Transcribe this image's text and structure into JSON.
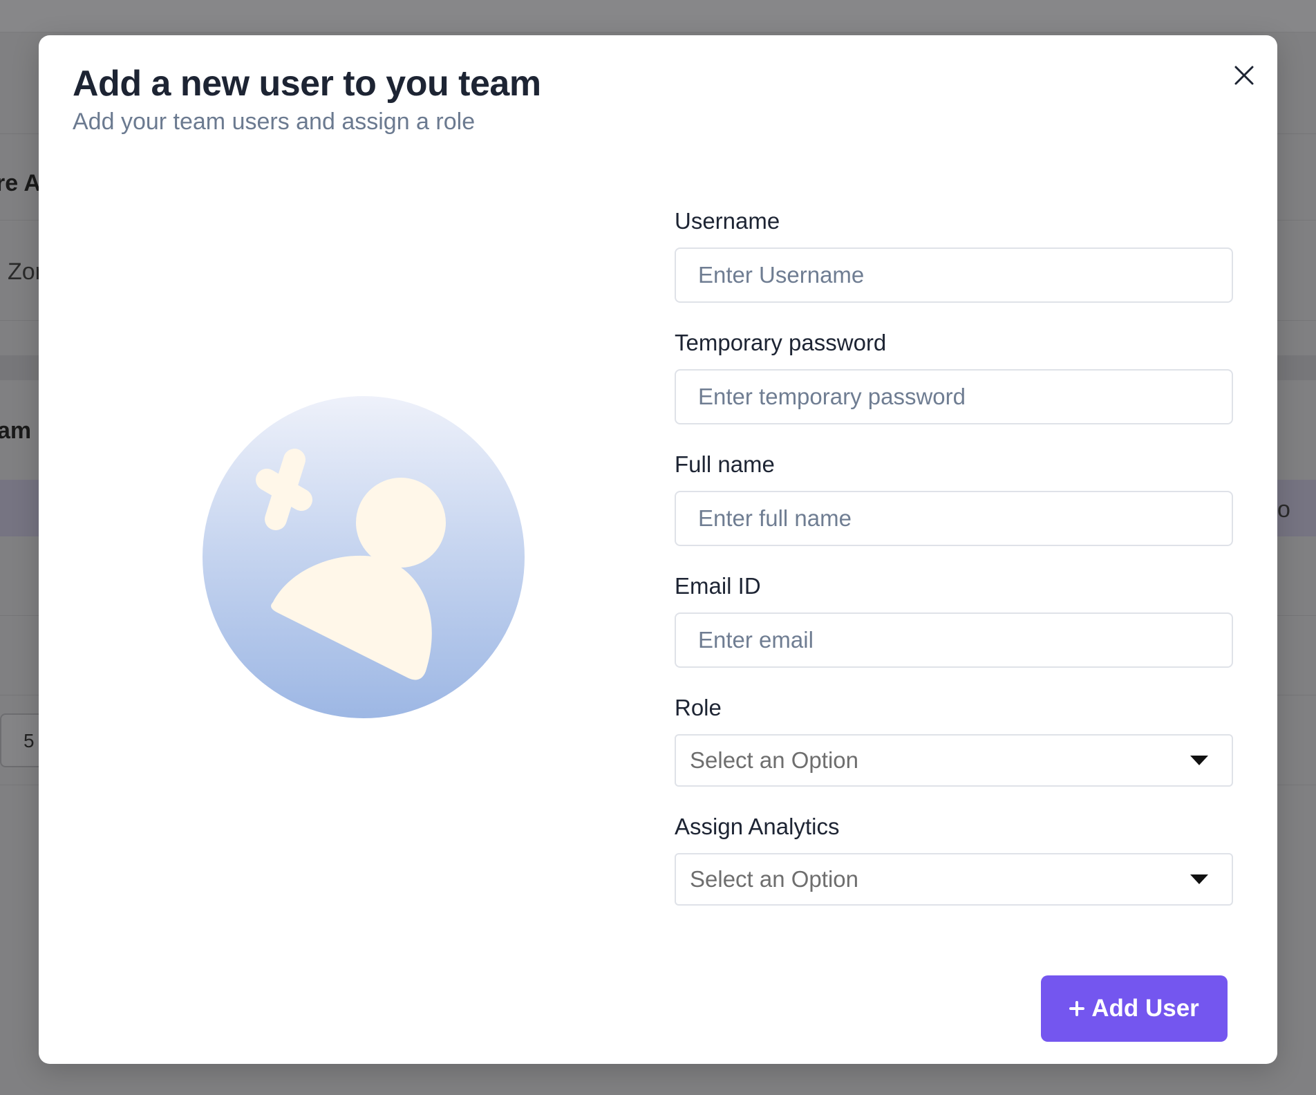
{
  "background": {
    "fragments": [
      "re A",
      "l Zon",
      "am",
      "o"
    ],
    "pager_value": "5"
  },
  "modal": {
    "title": "Add a new user to you team",
    "subtitle": "Add your team users and assign a role",
    "close_icon": "close-icon",
    "illustration_icon": "remove-user-avatar-icon",
    "fields": [
      {
        "label": "Username",
        "placeholder": "Enter Username",
        "value": ""
      },
      {
        "label": "Temporary password",
        "placeholder": "Enter temporary password",
        "value": ""
      },
      {
        "label": "Full name",
        "placeholder": "Enter full name",
        "value": ""
      },
      {
        "label": "Email ID",
        "placeholder": "Enter email",
        "value": ""
      }
    ],
    "selects": [
      {
        "label": "Role",
        "value": "Select an Option"
      },
      {
        "label": "Assign Analytics",
        "value": "Select an Option"
      }
    ],
    "submit_label": "Add User",
    "submit_icon": "plus-icon"
  },
  "colors": {
    "accent": "#7456ef",
    "title": "#1d2433",
    "subtitle": "#6b7a90",
    "overlay": "#808082"
  }
}
